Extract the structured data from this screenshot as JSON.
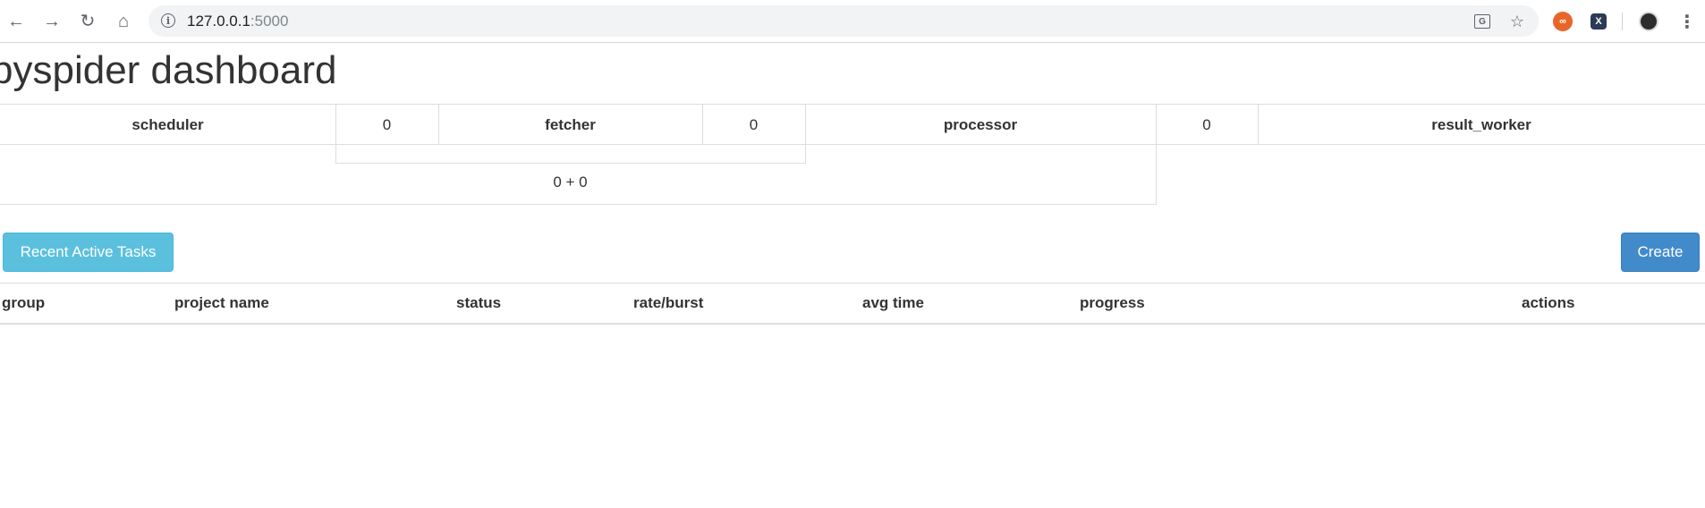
{
  "browser": {
    "url_host": "127.0.0.1",
    "url_port": ":5000",
    "icons": [
      "back-icon",
      "forward-icon",
      "reload-icon",
      "home-icon",
      "info-icon",
      "translate-icon",
      "star-icon",
      "extension-orange-icon",
      "extension-x-icon",
      "avatar-icon",
      "menu-icon"
    ]
  },
  "page": {
    "title": "pyspider dashboard"
  },
  "stats": {
    "scheduler_label": "scheduler",
    "scheduler_value": "0",
    "fetcher_label": "fetcher",
    "fetcher_value": "0",
    "processor_label": "processor",
    "processor_value": "0",
    "result_worker_label": "result_worker",
    "queue_text": "0 + 0"
  },
  "buttons": {
    "recent_active_tasks": "Recent Active Tasks",
    "create": "Create"
  },
  "table": {
    "headers": [
      "group",
      "project name",
      "status",
      "rate/burst",
      "avg time",
      "progress",
      "actions"
    ],
    "rows": []
  },
  "colors": {
    "info_button": "#5bc0de",
    "primary_button": "#428bca",
    "border": "#dddddd"
  }
}
